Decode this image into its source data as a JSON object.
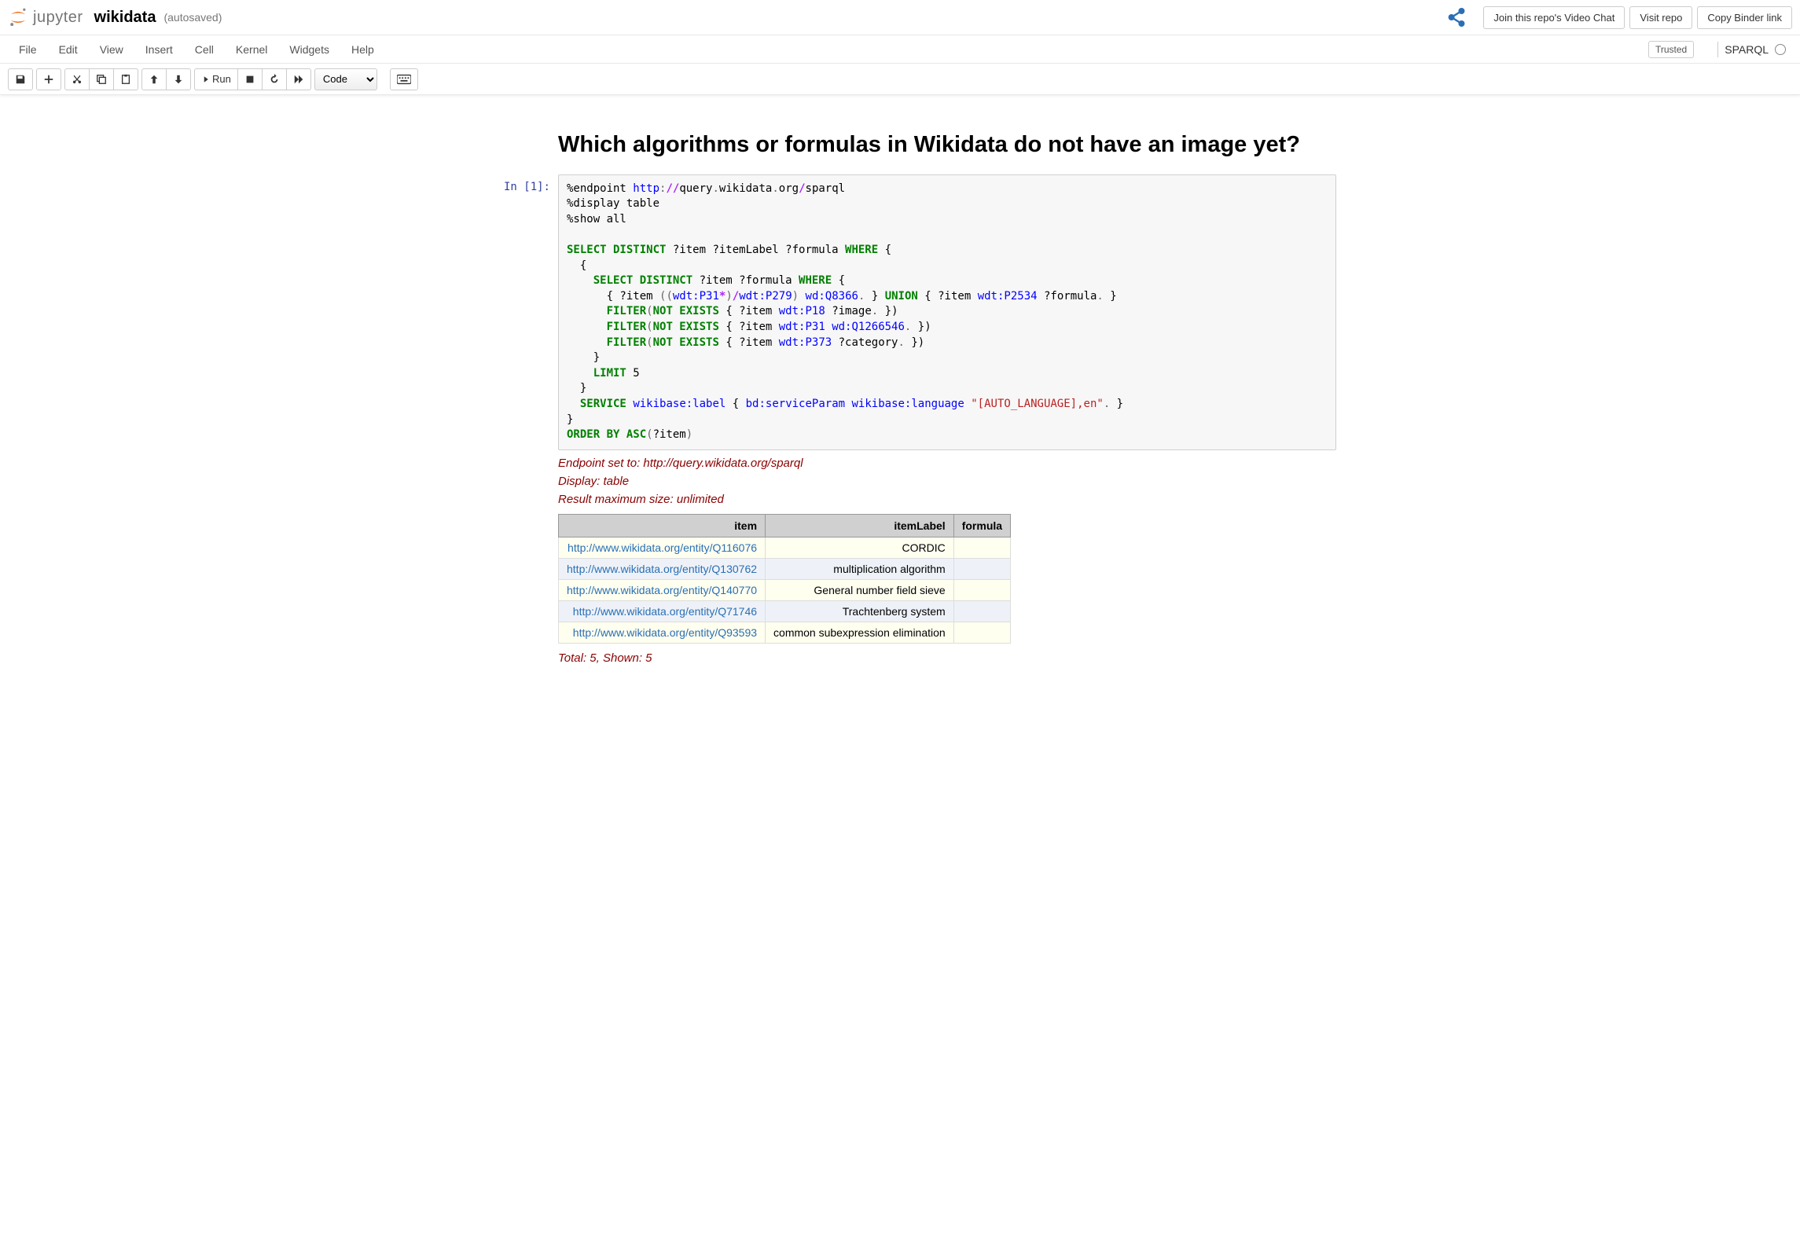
{
  "header": {
    "logo_text": "jupyter",
    "notebook_name": "wikidata",
    "autosave": "(autosaved)",
    "buttons": {
      "video_chat": "Join this repo's Video Chat",
      "visit_repo": "Visit repo",
      "copy_binder": "Copy Binder link"
    }
  },
  "menubar": {
    "items": [
      "File",
      "Edit",
      "View",
      "Insert",
      "Cell",
      "Kernel",
      "Widgets",
      "Help"
    ],
    "trusted": "Trusted",
    "kernel_name": "SPARQL"
  },
  "toolbar": {
    "run_label": "Run",
    "cell_type": "Code"
  },
  "notebook": {
    "markdown_heading": "Which algorithms or formulas in Wikidata do not have an image yet?",
    "prompt": "In [1]:",
    "code_lines": [
      [
        {
          "t": "%endpoint ",
          "c": "c-var"
        },
        {
          "t": "http",
          "c": "c-nm"
        },
        {
          "t": ":",
          "c": "c-punc"
        },
        {
          "t": "//",
          "c": "c-op"
        },
        {
          "t": "query",
          "c": "c-var"
        },
        {
          "t": ".",
          "c": "c-punc"
        },
        {
          "t": "wikidata",
          "c": "c-var"
        },
        {
          "t": ".",
          "c": "c-punc"
        },
        {
          "t": "org",
          "c": "c-var"
        },
        {
          "t": "/",
          "c": "c-op"
        },
        {
          "t": "sparql",
          "c": "c-var"
        }
      ],
      [
        {
          "t": "%display table",
          "c": "c-var"
        }
      ],
      [
        {
          "t": "%show all",
          "c": "c-var"
        }
      ],
      [],
      [
        {
          "t": "SELECT DISTINCT",
          "c": "c-kw"
        },
        {
          "t": " ?item ?itemLabel ?formula ",
          "c": "c-var"
        },
        {
          "t": "WHERE",
          "c": "c-kw"
        },
        {
          "t": " {",
          "c": "c-var"
        }
      ],
      [
        {
          "t": "  {",
          "c": "c-var"
        }
      ],
      [
        {
          "t": "    ",
          "c": ""
        },
        {
          "t": "SELECT DISTINCT",
          "c": "c-kw"
        },
        {
          "t": " ?item ?formula ",
          "c": "c-var"
        },
        {
          "t": "WHERE",
          "c": "c-kw"
        },
        {
          "t": " {",
          "c": "c-var"
        }
      ],
      [
        {
          "t": "      { ?item ",
          "c": "c-var"
        },
        {
          "t": "((",
          "c": "c-punc"
        },
        {
          "t": "wdt:P31",
          "c": "c-nm"
        },
        {
          "t": "*",
          "c": "c-op"
        },
        {
          "t": ")",
          "c": "c-punc"
        },
        {
          "t": "/",
          "c": "c-op"
        },
        {
          "t": "wdt:P279",
          "c": "c-nm"
        },
        {
          "t": ")",
          "c": "c-punc"
        },
        {
          "t": " ",
          "c": ""
        },
        {
          "t": "wd:Q8366",
          "c": "c-nm"
        },
        {
          "t": ".",
          "c": "c-punc"
        },
        {
          "t": " } ",
          "c": "c-var"
        },
        {
          "t": "UNION",
          "c": "c-kw"
        },
        {
          "t": " { ?item ",
          "c": "c-var"
        },
        {
          "t": "wdt:P2534",
          "c": "c-nm"
        },
        {
          "t": " ?formula",
          "c": "c-var"
        },
        {
          "t": ".",
          "c": "c-punc"
        },
        {
          "t": " }",
          "c": "c-var"
        }
      ],
      [
        {
          "t": "      ",
          "c": ""
        },
        {
          "t": "FILTER",
          "c": "c-kw"
        },
        {
          "t": "(",
          "c": "c-punc"
        },
        {
          "t": "NOT EXISTS",
          "c": "c-kw"
        },
        {
          "t": " { ?item ",
          "c": "c-var"
        },
        {
          "t": "wdt:P18",
          "c": "c-nm"
        },
        {
          "t": " ?image",
          "c": "c-var"
        },
        {
          "t": ".",
          "c": "c-punc"
        },
        {
          "t": " })",
          "c": "c-var"
        }
      ],
      [
        {
          "t": "      ",
          "c": ""
        },
        {
          "t": "FILTER",
          "c": "c-kw"
        },
        {
          "t": "(",
          "c": "c-punc"
        },
        {
          "t": "NOT EXISTS",
          "c": "c-kw"
        },
        {
          "t": " { ?item ",
          "c": "c-var"
        },
        {
          "t": "wdt:P31",
          "c": "c-nm"
        },
        {
          "t": " ",
          "c": ""
        },
        {
          "t": "wd:Q1266546",
          "c": "c-nm"
        },
        {
          "t": ".",
          "c": "c-punc"
        },
        {
          "t": " })",
          "c": "c-var"
        }
      ],
      [
        {
          "t": "      ",
          "c": ""
        },
        {
          "t": "FILTER",
          "c": "c-kw"
        },
        {
          "t": "(",
          "c": "c-punc"
        },
        {
          "t": "NOT EXISTS",
          "c": "c-kw"
        },
        {
          "t": " { ?item ",
          "c": "c-var"
        },
        {
          "t": "wdt:P373",
          "c": "c-nm"
        },
        {
          "t": " ?category",
          "c": "c-var"
        },
        {
          "t": ".",
          "c": "c-punc"
        },
        {
          "t": " })",
          "c": "c-var"
        }
      ],
      [
        {
          "t": "    }",
          "c": "c-var"
        }
      ],
      [
        {
          "t": "    ",
          "c": ""
        },
        {
          "t": "LIMIT",
          "c": "c-kw"
        },
        {
          "t": " 5",
          "c": "c-var"
        }
      ],
      [
        {
          "t": "  }",
          "c": "c-var"
        }
      ],
      [
        {
          "t": "  ",
          "c": ""
        },
        {
          "t": "SERVICE",
          "c": "c-kw"
        },
        {
          "t": " ",
          "c": ""
        },
        {
          "t": "wikibase:label",
          "c": "c-nm"
        },
        {
          "t": " { ",
          "c": "c-var"
        },
        {
          "t": "bd:serviceParam",
          "c": "c-nm"
        },
        {
          "t": " ",
          "c": ""
        },
        {
          "t": "wikibase:language",
          "c": "c-nm"
        },
        {
          "t": " ",
          "c": ""
        },
        {
          "t": "\"[AUTO_LANGUAGE],en\"",
          "c": "c-str"
        },
        {
          "t": ".",
          "c": "c-punc"
        },
        {
          "t": " }",
          "c": "c-var"
        }
      ],
      [
        {
          "t": "}",
          "c": "c-var"
        }
      ],
      [
        {
          "t": "ORDER BY ASC",
          "c": "c-kw"
        },
        {
          "t": "(",
          "c": "c-punc"
        },
        {
          "t": "?item",
          "c": "c-var"
        },
        {
          "t": ")",
          "c": "c-punc"
        }
      ]
    ],
    "output": {
      "status": [
        "Endpoint set to: http://query.wikidata.org/sparql",
        "Display: table",
        "Result maximum size: unlimited"
      ],
      "columns": [
        "item",
        "itemLabel",
        "formula"
      ],
      "rows": [
        {
          "item": "http://www.wikidata.org/entity/Q116076",
          "itemLabel": "CORDIC",
          "formula": ""
        },
        {
          "item": "http://www.wikidata.org/entity/Q130762",
          "itemLabel": "multiplication algorithm",
          "formula": ""
        },
        {
          "item": "http://www.wikidata.org/entity/Q140770",
          "itemLabel": "General number field sieve",
          "formula": ""
        },
        {
          "item": "http://www.wikidata.org/entity/Q71746",
          "itemLabel": "Trachtenberg system",
          "formula": ""
        },
        {
          "item": "http://www.wikidata.org/entity/Q93593",
          "itemLabel": "common subexpression elimination",
          "formula": ""
        }
      ],
      "summary": "Total: 5, Shown: 5"
    }
  }
}
